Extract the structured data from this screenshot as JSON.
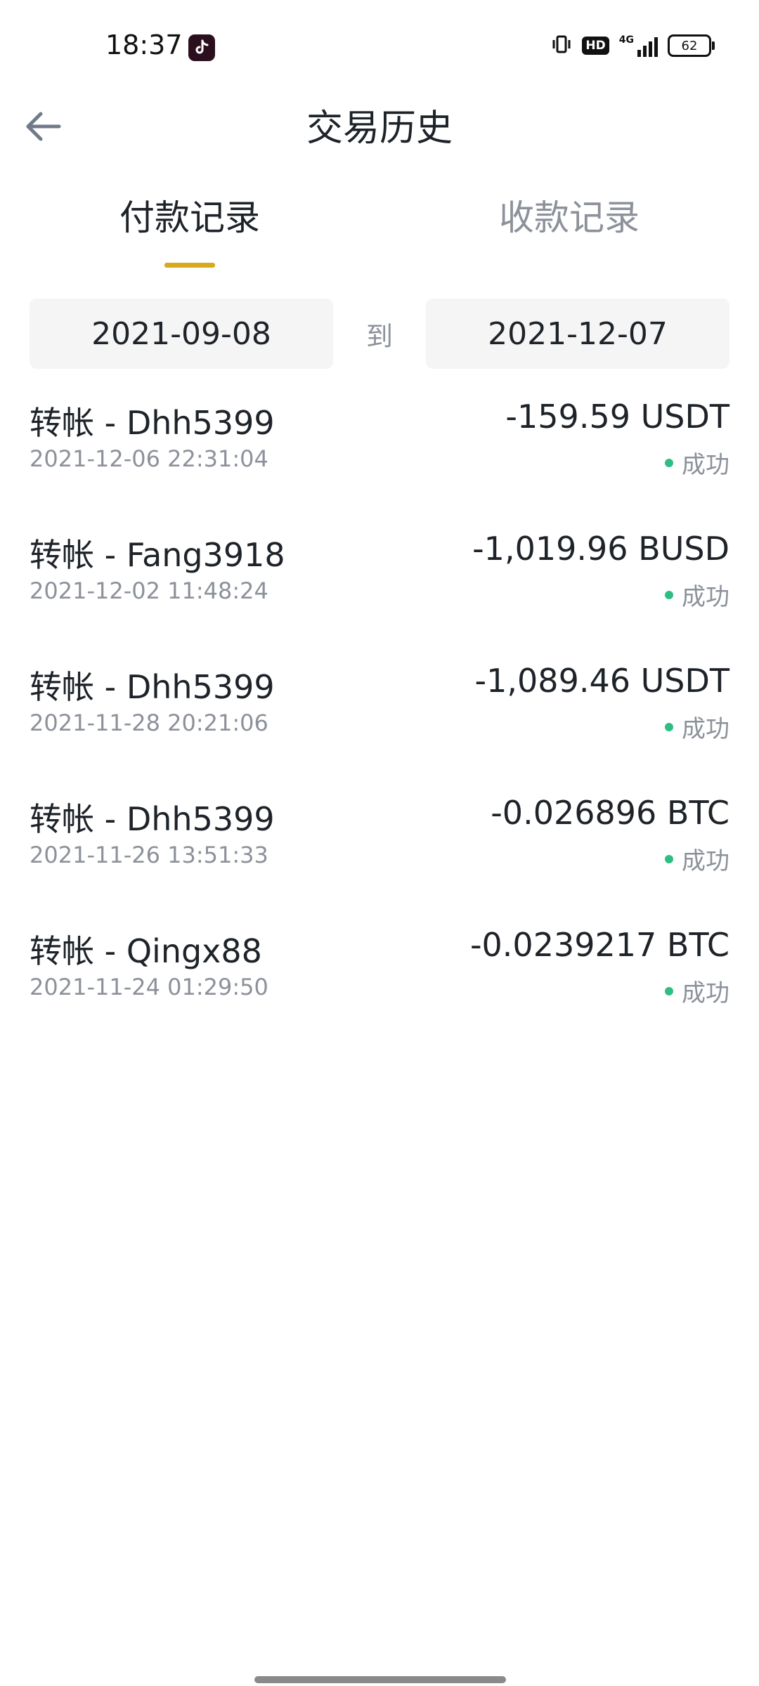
{
  "status_bar": {
    "time": "18:37",
    "network": "4G",
    "hd": "HD",
    "battery": "62",
    "app_icon": "tiktok-icon"
  },
  "header": {
    "title": "交易历史",
    "back_icon": "arrow-left-icon"
  },
  "tabs": [
    {
      "label": "付款记录",
      "active": true
    },
    {
      "label": "收款记录",
      "active": false
    }
  ],
  "date_range": {
    "start": "2021-09-08",
    "separator": "到",
    "end": "2021-12-07"
  },
  "transactions": [
    {
      "title": "转帐 - Dhh5399",
      "time": "2021-12-06 22:31:04",
      "amount": "-159.59 USDT",
      "status": "成功"
    },
    {
      "title": "转帐 - Fang3918",
      "time": "2021-12-02 11:48:24",
      "amount": "-1,019.96 BUSD",
      "status": "成功"
    },
    {
      "title": "转帐 - Dhh5399",
      "time": "2021-11-28 20:21:06",
      "amount": "-1,089.46 USDT",
      "status": "成功"
    },
    {
      "title": "转帐 - Dhh5399",
      "time": "2021-11-26 13:51:33",
      "amount": "-0.026896 BTC",
      "status": "成功"
    },
    {
      "title": "转帐 - Qingx88",
      "time": "2021-11-24 01:29:50",
      "amount": "-0.0239217 BTC",
      "status": "成功"
    }
  ],
  "colors": {
    "accent": "#d8a91c",
    "success": "#2ebd85",
    "text_primary": "#1e2329",
    "text_secondary": "#8c919a",
    "date_bg": "#f5f5f5"
  }
}
